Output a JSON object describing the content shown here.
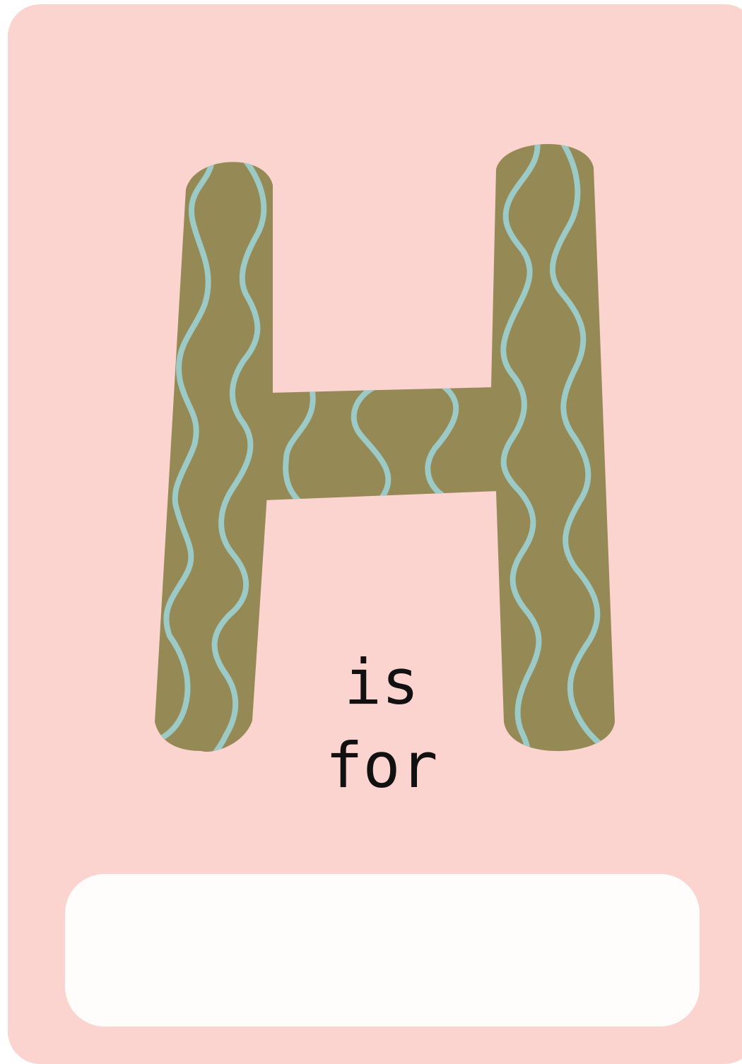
{
  "flashcard": {
    "letter": "H",
    "caption_line1": "is",
    "caption_line2": "for",
    "answer_value": ""
  },
  "colors": {
    "card_background": "#fbd4cf",
    "letter_fill": "#958a56",
    "letter_pattern": "#9ccac6",
    "answer_box": "#fffcfc",
    "text": "#111111"
  }
}
